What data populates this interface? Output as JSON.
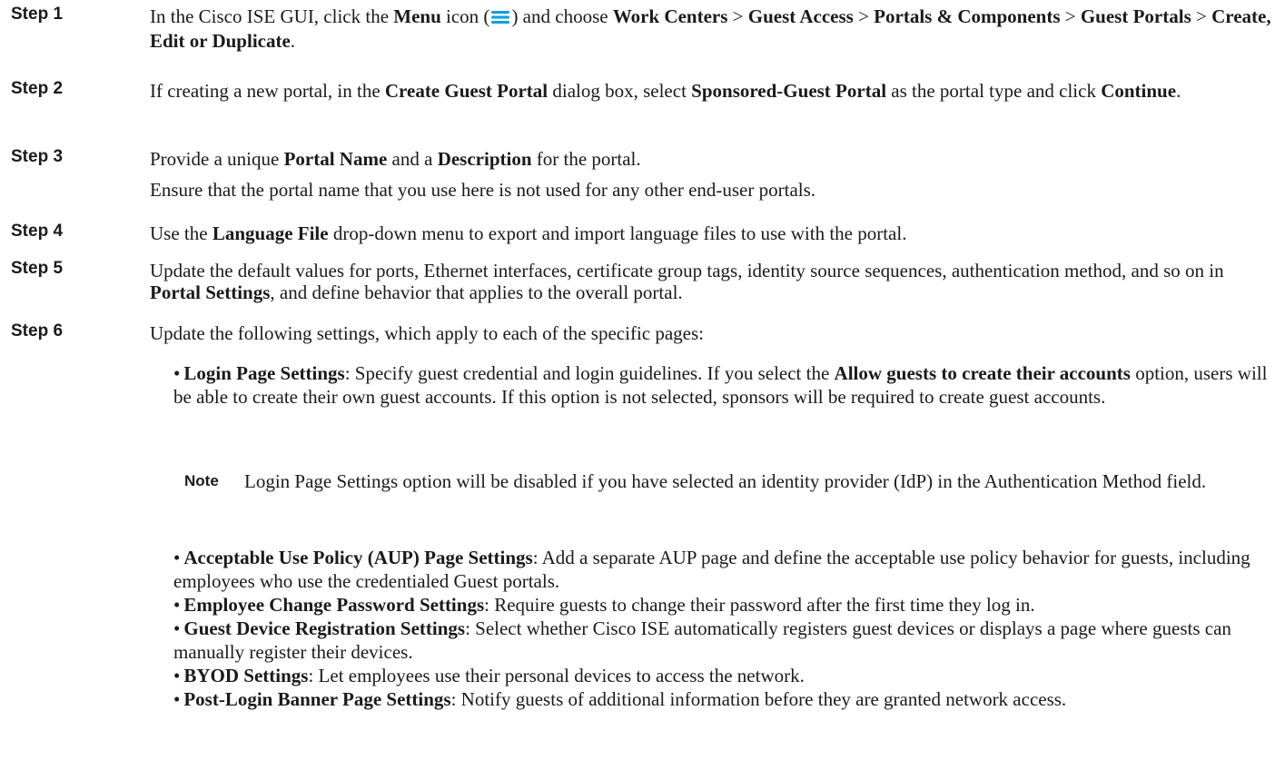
{
  "steps": [
    {
      "label": "Step 1",
      "parts": {
        "t1": "In the Cisco ISE GUI, click the ",
        "b1": "Menu",
        "t2": " icon (",
        "t3": ") and choose ",
        "b2": "Work Centers",
        "t4": " > ",
        "b3": "Guest Access",
        "t5": " > ",
        "b4": "Portals & Components",
        "t6": " > ",
        "b5": "Guest Portals",
        "t7": " > ",
        "b6": "Create, Edit or Duplicate",
        "t8": "."
      }
    },
    {
      "label": "Step 2",
      "parts": {
        "t1": "If creating a new portal, in the ",
        "b1": "Create Guest Portal",
        "t2": " dialog box, select ",
        "b2": "Sponsored-Guest Portal",
        "t3": " as the portal type and click ",
        "b3": "Continue",
        "t4": "."
      }
    },
    {
      "label": "Step 3",
      "parts": {
        "t1": "Provide a unique ",
        "b1": "Portal Name",
        "t2": " and a ",
        "b2": "Description",
        "t3": " for the portal.",
        "extra": "Ensure that the portal name that you use here is not used for any other end-user portals."
      }
    },
    {
      "label": "Step 4",
      "parts": {
        "t1": "Use the ",
        "b1": "Language File",
        "t2": " drop-down menu to export and import language files to use with the portal."
      }
    },
    {
      "label": "Step 5",
      "parts": {
        "t1": "Update the default values for ports, Ethernet interfaces, certificate group tags, identity source sequences, authentication method, and so on in ",
        "b1": "Portal Settings",
        "t2": ", and define behavior that applies to the overall portal."
      }
    },
    {
      "label": "Step 6",
      "parts": {
        "t1": "Update the following settings, which apply to each of the specific pages:"
      }
    }
  ],
  "bullet_char": "•",
  "login_item": {
    "b1": "Login Page Settings",
    "t1": ": Specify guest credential and login guidelines. If you select the ",
    "b2": "Allow guests to create their accounts",
    "t2": " option, users will be able to create their own guest accounts. If this option is not selected, sponsors will be required to create guest accounts."
  },
  "note": {
    "label": "Note",
    "text": "Login Page Settings option will be disabled if you have selected an identity provider (IdP) in the Authentication Method field."
  },
  "items": [
    {
      "b": "Acceptable Use Policy (AUP) Page Settings",
      "t": ": Add a separate AUP page and define the acceptable use policy behavior for guests, including employees who use the credentialed Guest portals."
    },
    {
      "b": "Employee Change Password Settings",
      "t": ": Require guests to change their password after the first time they log in."
    },
    {
      "b": "Guest Device Registration Settings",
      "t": ": Select whether Cisco ISE automatically registers guest devices or displays a page where guests can manually register their devices."
    },
    {
      "b": "BYOD Settings",
      "t": ": Let employees use their personal devices to access the network."
    },
    {
      "b": "Post-Login Banner Page Settings",
      "t": ": Notify guests of additional information before they are granted network access."
    }
  ],
  "colors": {
    "menu_icon": "#049fd9",
    "text": "#1a1a1a"
  },
  "icons": {
    "menu": "hamburger-menu-icon"
  }
}
